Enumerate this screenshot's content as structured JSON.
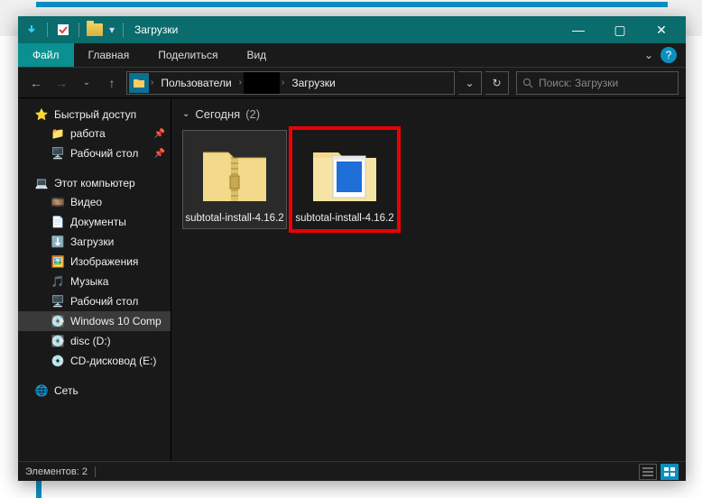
{
  "window": {
    "title": "Загрузки",
    "tabs": {
      "file": "Файл",
      "home": "Главная",
      "share": "Поделиться",
      "view": "Вид"
    }
  },
  "breadcrumbs": {
    "seg1": "Пользователи",
    "seg2": "",
    "seg3": "Загрузки"
  },
  "search": {
    "placeholder": "Поиск: Загрузки"
  },
  "sidebar": {
    "quick": "Быстрый доступ",
    "q_items": [
      "работа",
      "Рабочий стол"
    ],
    "pc": "Этот компьютер",
    "p_items": [
      "Видео",
      "Документы",
      "Загрузки",
      "Изображения",
      "Музыка",
      "Рабочий стол",
      "Windows 10 Comp",
      "disc (D:)",
      "CD-дисковод (E:)"
    ],
    "net": "Сеть"
  },
  "group": {
    "label": "Сегодня",
    "count": "(2)"
  },
  "items": [
    {
      "name": "subtotal-install-4.16.2",
      "type": "zip"
    },
    {
      "name": "subtotal-install-4.16.2",
      "type": "folder"
    }
  ],
  "status": {
    "elements": "Элементов: 2"
  }
}
